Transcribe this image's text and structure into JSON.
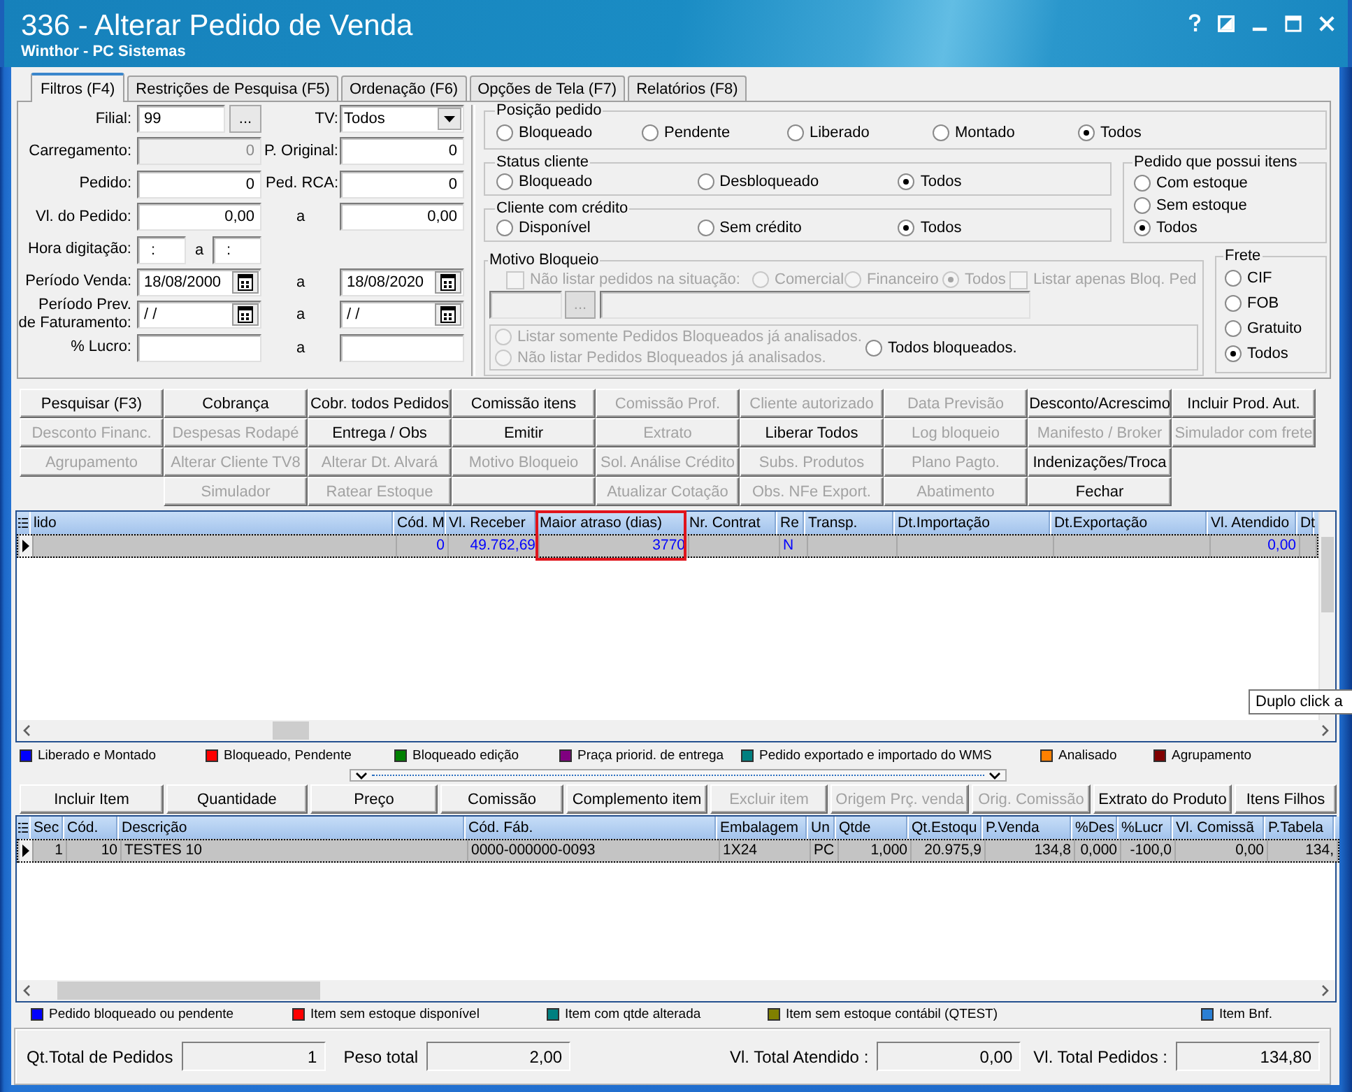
{
  "window": {
    "title": "336 - Alterar Pedido de Venda",
    "subtitle": "Winthor - PC Sistemas"
  },
  "tabs": [
    {
      "label": "Filtros (F4)",
      "selected": true
    },
    {
      "label": "Restrições de Pesquisa (F5)",
      "selected": false
    },
    {
      "label": "Ordenação (F6)",
      "selected": false
    },
    {
      "label": "Opções de Tela (F7)",
      "selected": false
    },
    {
      "label": "Relatórios (F8)",
      "selected": false
    }
  ],
  "filters": {
    "filial": {
      "label": "Filial:",
      "value": "99",
      "button": "..."
    },
    "tv": {
      "label": "TV:",
      "value": "Todos"
    },
    "carregamento": {
      "label": "Carregamento:",
      "value": "0",
      "disabled": true
    },
    "p_original": {
      "label": "P. Original:",
      "value": "0"
    },
    "pedido": {
      "label": "Pedido:",
      "value": "0"
    },
    "ped_rca": {
      "label": "Ped. RCA:",
      "value": "0"
    },
    "ranges": [
      {
        "kind": "number",
        "label": "Vl. do Pedido:",
        "from": "0,00",
        "separator": "a",
        "to": "0,00"
      },
      {
        "kind": "time",
        "label": "Hora digitação:",
        "from": ":",
        "separator": "a",
        "to": ":"
      },
      {
        "kind": "date",
        "label": "Período Venda:",
        "from": "18/08/2000",
        "separator": "a",
        "to": "18/08/2020"
      },
      {
        "kind": "date",
        "label": "Período Prev. de Faturamento:",
        "from": "/ /",
        "separator": "a",
        "to": "/ /"
      },
      {
        "kind": "number",
        "label": "% Lucro:",
        "separator": "a"
      }
    ]
  },
  "posicao_pedido": {
    "title": "Posição pedido",
    "options": [
      {
        "label": "Bloqueado",
        "selected": false
      },
      {
        "label": "Pendente",
        "selected": false
      },
      {
        "label": "Liberado",
        "selected": false
      },
      {
        "label": "Montado",
        "selected": false
      },
      {
        "label": "Todos",
        "selected": true
      }
    ]
  },
  "status_cliente": {
    "title": "Status cliente",
    "options": [
      {
        "label": "Bloqueado",
        "selected": false
      },
      {
        "label": "Desbloqueado",
        "selected": false
      },
      {
        "label": "Todos",
        "selected": true
      }
    ]
  },
  "cliente_credito": {
    "title": "Cliente com crédito",
    "options": [
      {
        "label": "Disponível",
        "selected": false
      },
      {
        "label": "Sem crédito",
        "selected": false
      },
      {
        "label": "Todos",
        "selected": true
      }
    ]
  },
  "pedido_itens": {
    "title": "Pedido que possui itens",
    "options": [
      {
        "label": "Com estoque",
        "selected": false
      },
      {
        "label": "Sem estoque",
        "selected": false
      },
      {
        "label": "Todos",
        "selected": true
      }
    ]
  },
  "motivo_bloqueio": {
    "title": "Motivo Bloqueio",
    "disabled": true,
    "exclude": {
      "label": "Não listar pedidos na situação:",
      "checked": false
    },
    "situacao": [
      {
        "label": "Comercial",
        "selected": false
      },
      {
        "label": "Financeiro",
        "selected": false
      },
      {
        "label": "Todos",
        "selected": true
      }
    ],
    "only_blocked": {
      "label": "Listar apenas Bloq. Ped",
      "checked": false
    },
    "button": "...",
    "analysis": [
      {
        "label": "Listar somente Pedidos Bloqueados já analisados.",
        "selected": false,
        "disabled": true
      },
      {
        "label": "Não listar Pedidos Bloqueados já analisados.",
        "selected": false,
        "disabled": true
      },
      {
        "label": "Todos bloqueados.",
        "selected": false,
        "disabled": false
      }
    ]
  },
  "frete": {
    "title": "Frete",
    "options": [
      {
        "label": "CIF",
        "selected": false
      },
      {
        "label": "FOB",
        "selected": false
      },
      {
        "label": "Gratuito",
        "selected": false
      },
      {
        "label": "Todos",
        "selected": true
      }
    ]
  },
  "actions": {
    "columns": [
      [
        {
          "kind": "button",
          "label": "Pesquisar (F3)",
          "disabled": false
        },
        {
          "kind": "button",
          "label": "Desconto Financ.",
          "disabled": true
        },
        {
          "kind": "button",
          "label": "Agrupamento",
          "disabled": true
        }
      ],
      [
        {
          "kind": "button",
          "label": "Cobrança",
          "disabled": false
        },
        {
          "kind": "button",
          "label": "Despesas Rodapé",
          "disabled": true
        },
        {
          "kind": "button",
          "label": "Alterar Cliente TV8",
          "disabled": true
        },
        {
          "kind": "button",
          "label": "Simulador",
          "disabled": true
        }
      ],
      [
        {
          "kind": "button",
          "label": "Cobr. todos Pedidos",
          "disabled": false
        },
        {
          "kind": "button",
          "label": "Entrega / Obs",
          "disabled": false
        },
        {
          "kind": "button",
          "label": "Alterar Dt. Alvará",
          "disabled": true
        },
        {
          "kind": "button",
          "label": "Ratear Estoque",
          "disabled": true
        }
      ],
      [
        {
          "kind": "button",
          "label": "Comissão itens",
          "disabled": false
        },
        {
          "kind": "button",
          "label": "Emitir",
          "disabled": false
        },
        {
          "kind": "button",
          "label": "Motivo Bloqueio",
          "disabled": true
        },
        {
          "kind": "blank"
        }
      ],
      [
        {
          "kind": "button",
          "label": "Comissão Prof.",
          "disabled": true
        },
        {
          "kind": "button",
          "label": "Extrato",
          "disabled": true
        },
        {
          "kind": "button",
          "label": "Sol. Análise Crédito",
          "disabled": true
        },
        {
          "kind": "button",
          "label": "Atualizar Cotação",
          "disabled": true
        }
      ],
      [
        {
          "kind": "button",
          "label": "Cliente autorizado",
          "disabled": true
        },
        {
          "kind": "button",
          "label": "Liberar Todos",
          "disabled": false
        },
        {
          "kind": "button",
          "label": "Subs. Produtos",
          "disabled": true
        },
        {
          "kind": "button",
          "label": "Obs. NFe Export.",
          "disabled": true
        }
      ],
      [
        {
          "kind": "button",
          "label": "Data Previsão",
          "disabled": true
        },
        {
          "kind": "button",
          "label": "Log bloqueio",
          "disabled": true
        },
        {
          "kind": "button",
          "label": "Plano Pagto.",
          "disabled": true
        },
        {
          "kind": "button",
          "label": "Abatimento",
          "disabled": true
        }
      ],
      [
        {
          "kind": "button",
          "label": "Desconto/Acrescimo",
          "disabled": false
        },
        {
          "kind": "button",
          "label": "Manifesto / Broker",
          "disabled": true
        },
        {
          "kind": "button",
          "label": "Indenizações/Troca",
          "disabled": false
        },
        {
          "kind": "button",
          "label": "Fechar",
          "disabled": false
        }
      ],
      [
        {
          "kind": "button",
          "label": "Incluir Prod. Aut.",
          "disabled": false
        },
        {
          "kind": "button",
          "label": "Simulador com frete",
          "disabled": true
        }
      ]
    ]
  },
  "orders_grid": {
    "columns": [
      {
        "label": "lido",
        "highlighted": false
      },
      {
        "label": "Cód. M",
        "highlighted": false
      },
      {
        "label": "Vl. Receber",
        "highlighted": false
      },
      {
        "label": "Maior atraso (dias)",
        "highlighted": true
      },
      {
        "label": "Nr. Contrat",
        "highlighted": false
      },
      {
        "label": "Re",
        "highlighted": false
      },
      {
        "label": "Transp.",
        "highlighted": false
      },
      {
        "label": "Dt.Importação",
        "highlighted": false
      },
      {
        "label": "Dt.Exportação",
        "highlighted": false
      },
      {
        "label": "Vl. Atendido",
        "highlighted": false
      },
      {
        "label": "Dt",
        "highlighted": false
      }
    ],
    "rows": [
      {
        "selected": true,
        "color": "#0000ff",
        "cells": [
          null,
          "0",
          "49.762,69",
          "3770",
          null,
          "N",
          null,
          null,
          null,
          "0,00",
          null
        ]
      }
    ],
    "tooltip": "Duplo click a"
  },
  "legend": [
    {
      "label": "Liberado e Montado",
      "color": "#0000ff"
    },
    {
      "label": "Bloqueado, Pendente",
      "color": "#ff0000"
    },
    {
      "label": "Bloqueado edição",
      "color": "#008000"
    },
    {
      "label": "Praça priorid. de entrega",
      "color": "#800080"
    },
    {
      "label": "Pedido exportado e importado do WMS",
      "color": "#008080"
    },
    {
      "label": "Analisado",
      "color": "#ff8000"
    },
    {
      "label": "Agrupamento",
      "color": "#800000"
    }
  ],
  "item_actions": [
    {
      "label": "Incluir Item",
      "disabled": false
    },
    {
      "label": "Quantidade",
      "disabled": false
    },
    {
      "label": "Preço",
      "disabled": false
    },
    {
      "label": "Comissão",
      "disabled": false
    },
    {
      "label": "Complemento item",
      "disabled": false
    },
    {
      "label": "Excluir item",
      "disabled": true
    },
    {
      "label": "Origem Prç. venda",
      "disabled": true
    },
    {
      "label": "Orig. Comissão",
      "disabled": true
    },
    {
      "label": "Extrato do Produto",
      "disabled": false
    },
    {
      "label": "Itens Filhos",
      "disabled": false
    }
  ],
  "items_grid": {
    "columns": [
      {
        "label": "Sec"
      },
      {
        "label": "Cód."
      },
      {
        "label": "Descrição"
      },
      {
        "label": "Cód. Fáb."
      },
      {
        "label": "Embalagem"
      },
      {
        "label": "Un"
      },
      {
        "label": "Qtde"
      },
      {
        "label": "Qt.Estoqu"
      },
      {
        "label": "P.Venda"
      },
      {
        "label": "%Des"
      },
      {
        "label": "%Lucr"
      },
      {
        "label": "Vl. Comissã"
      },
      {
        "label": "P.Tabela"
      }
    ],
    "rows": [
      {
        "selected": true,
        "cells": [
          "1",
          "10",
          "TESTES 10",
          "0000-000000-0093",
          "1X24",
          "PC",
          "1,000",
          "20.975,9",
          "134,8",
          "0,000",
          "-100,0",
          "0,00",
          "134,"
        ]
      }
    ]
  },
  "item_legend": [
    {
      "label": "Pedido bloqueado ou pendente",
      "color": "#0000ff"
    },
    {
      "label": "Item sem estoque disponível",
      "color": "#ff0000"
    },
    {
      "label": "Item com qtde alterada",
      "color": "#008080"
    },
    {
      "label": "Item sem estoque contábil (QTEST)",
      "color": "#808000"
    },
    {
      "label": "Item Bnf.",
      "color": "#2a7fd4"
    }
  ],
  "totals": [
    {
      "label": "Qt.Total de Pedidos",
      "value": "1"
    },
    {
      "label": "Peso total",
      "value": "2,00"
    },
    {
      "label": "Vl. Total Atendido :",
      "value": "0,00"
    },
    {
      "label": "Vl. Total Pedidos :",
      "value": "134,80"
    }
  ]
}
